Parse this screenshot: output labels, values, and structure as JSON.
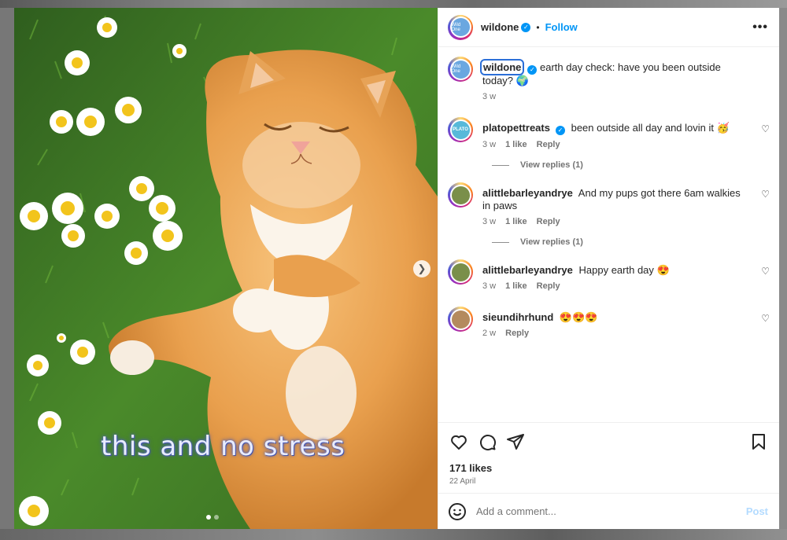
{
  "post": {
    "author": "wildone",
    "follow_label": "Follow",
    "sep": "•",
    "more_label": "•••",
    "avatar_text": "Wild One",
    "overlay_text": "this and no stress",
    "caption_text": "earth day check: have you been outside today? 🌍",
    "caption_time": "3 w"
  },
  "comments": [
    {
      "user": "platopettreats",
      "verified": true,
      "text": "been outside all day and lovin it 🥳",
      "time": "3 w",
      "likes": "1 like",
      "reply": "Reply",
      "avatar_text": "PLATO",
      "replies_label": "View replies (1)"
    },
    {
      "user": "alittlebarleyandrye",
      "verified": false,
      "text": "And my pups got there 6am walkies in paws",
      "time": "3 w",
      "likes": "1 like",
      "reply": "Reply",
      "replies_label": "View replies (1)"
    },
    {
      "user": "alittlebarleyandrye",
      "verified": false,
      "text": "Happy earth day 😍",
      "time": "3 w",
      "likes": "1 like",
      "reply": "Reply"
    },
    {
      "user": "sieundihrhund",
      "verified": false,
      "text": "😍😍😍",
      "time": "2 w",
      "reply": "Reply"
    }
  ],
  "stats": {
    "likes": "171 likes",
    "date": "22 April"
  },
  "composer": {
    "placeholder": "Add a comment...",
    "post_label": "Post"
  },
  "icons": {
    "heart": "heart-icon",
    "comment": "comment-icon",
    "share": "share-icon",
    "save": "bookmark-icon",
    "emoji": "emoji-icon",
    "next": "chevron-right-icon"
  },
  "colors": {
    "accent": "#0095f6",
    "post_disabled": "#b3dbff",
    "overlay_text": "#e8ecff"
  }
}
